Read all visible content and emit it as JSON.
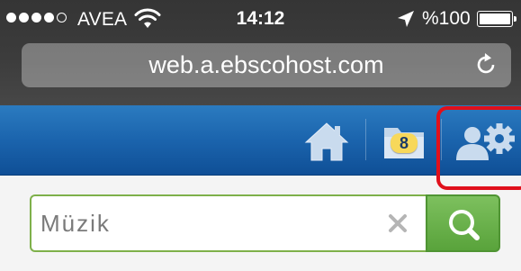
{
  "status_bar": {
    "carrier": "AVEA",
    "time": "14:12",
    "battery": "%100",
    "signal_bars_filled": 4,
    "signal_bars_total": 5,
    "battery_level": 1.0,
    "icons": [
      "signal-dots-icon",
      "wifi-icon",
      "location-arrow-icon",
      "battery-icon"
    ]
  },
  "browser": {
    "url": "web.a.ebscohost.com",
    "icons": [
      "reload-icon"
    ]
  },
  "header": {
    "folder_count": "8",
    "icons": [
      "home-icon",
      "folder-icon",
      "preferences-icon"
    ],
    "highlight_color": "#e0101b",
    "colors": {
      "top": "#2b7bc0",
      "bottom": "#0f4f96"
    }
  },
  "search": {
    "placeholder": "Müzik",
    "value": "",
    "icons": [
      "clear-icon",
      "search-icon"
    ],
    "accent": "#59a33b",
    "border": "#7eb04a"
  }
}
